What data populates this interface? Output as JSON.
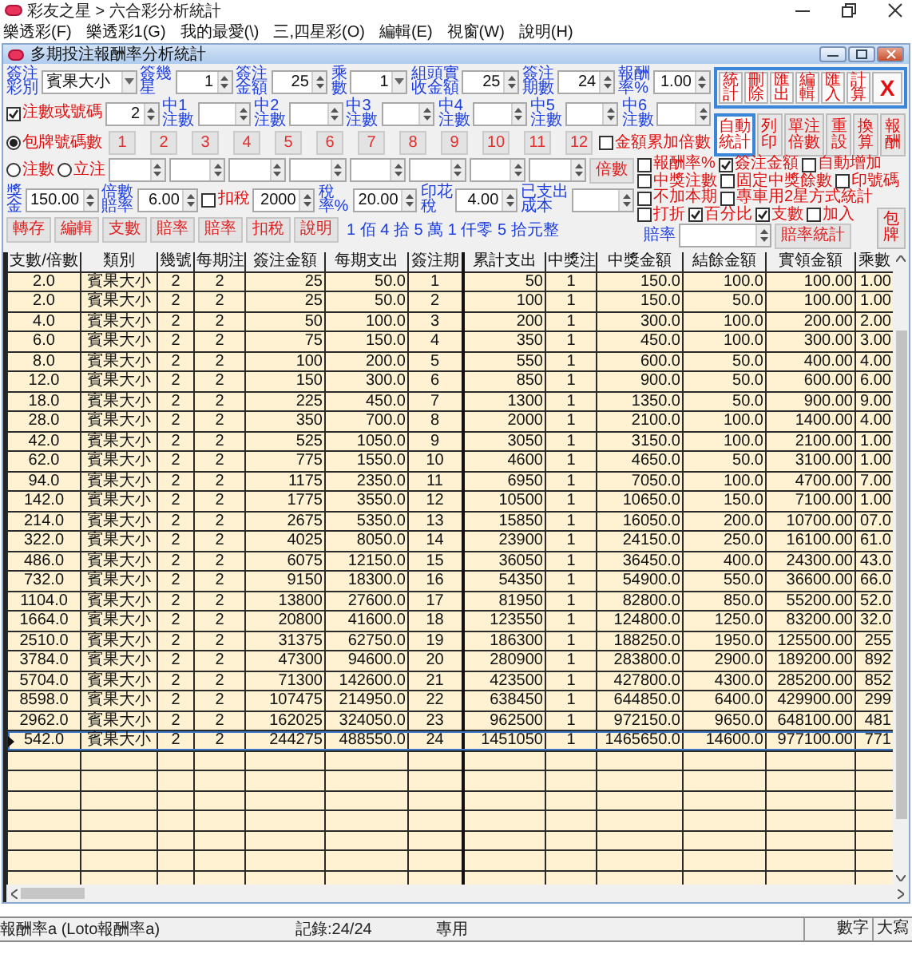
{
  "window": {
    "title": "彩友之星 > 六合彩分析統計"
  },
  "menu": [
    "樂透彩(F)",
    "樂透彩1(G)",
    "我的最愛(\\)",
    "三,四星彩(O)",
    "編輯(E)",
    "視窗(W)",
    "說明(H)"
  ],
  "dialog": {
    "title": "多期投注報酬率分析統計"
  },
  "form": {
    "upper_rows": [
      [
        {
          "kind": "label",
          "text": "簽注彩別"
        },
        {
          "kind": "select",
          "value": "賓果大小"
        },
        {
          "kind": "label",
          "text": "簽幾星"
        },
        {
          "kind": "spin",
          "value": "1"
        },
        {
          "kind": "label",
          "text": "簽注金額"
        },
        {
          "kind": "spin",
          "value": "25"
        },
        {
          "kind": "label",
          "text": "乘數"
        },
        {
          "kind": "select",
          "value": "1"
        },
        {
          "kind": "label",
          "text": "組頭實收金額"
        },
        {
          "kind": "spin",
          "value": "25"
        },
        {
          "kind": "label",
          "text": "簽注期數"
        },
        {
          "kind": "spin",
          "value": "24"
        },
        {
          "kind": "label",
          "text": "報酬率%"
        },
        {
          "kind": "spin",
          "value": "1.00"
        }
      ],
      [
        {
          "kind": "checkbox",
          "label": "注數或號碼",
          "checked": true
        },
        {
          "kind": "spin",
          "value": "2"
        },
        {
          "kind": "label",
          "text": "中1注數"
        },
        {
          "kind": "spin"
        },
        {
          "kind": "label",
          "text": "中2注數"
        },
        {
          "kind": "spin"
        },
        {
          "kind": "label",
          "text": "中3注數"
        },
        {
          "kind": "spin"
        },
        {
          "kind": "label",
          "text": "中4注數"
        },
        {
          "kind": "spin"
        },
        {
          "kind": "label",
          "text": "中5注數"
        },
        {
          "kind": "spin"
        },
        {
          "kind": "label",
          "text": "中6注數"
        },
        {
          "kind": "spin"
        }
      ],
      [
        {
          "kind": "radio",
          "label": "包牌號碼數",
          "selected": true
        },
        {
          "kind": "number_buttons",
          "labels": [
            "1",
            "2",
            "3",
            "4",
            "5",
            "6",
            "7",
            "8",
            "9",
            "10",
            "11",
            "12"
          ]
        },
        {
          "kind": "checkbox",
          "label": "金額累加倍數",
          "checked": false
        }
      ]
    ],
    "lower_rows": [
      [
        {
          "kind": "radio",
          "label": "注數",
          "selected": false
        },
        {
          "kind": "radio",
          "label": "立注",
          "selected": false
        },
        {
          "kind": "spin"
        },
        {
          "kind": "spin"
        },
        {
          "kind": "spin"
        },
        {
          "kind": "spin"
        },
        {
          "kind": "spin"
        },
        {
          "kind": "spin"
        },
        {
          "kind": "spin"
        },
        {
          "kind": "spin"
        },
        {
          "kind": "button",
          "label": "倍數"
        }
      ],
      [
        {
          "kind": "label",
          "text": "獎金"
        },
        {
          "kind": "spin",
          "value": "150.00"
        },
        {
          "kind": "label",
          "text": "倍數賠率"
        },
        {
          "kind": "spin",
          "value": "6.00"
        },
        {
          "kind": "checkbox",
          "label": "扣稅",
          "checked": false
        },
        {
          "kind": "spin",
          "value": "2000"
        },
        {
          "kind": "label",
          "text": "稅率%"
        },
        {
          "kind": "spin",
          "value": "20.00"
        },
        {
          "kind": "label",
          "text": "印花稅"
        },
        {
          "kind": "spin",
          "value": "4.00"
        },
        {
          "kind": "label",
          "text": "已支出成本"
        },
        {
          "kind": "spin"
        }
      ],
      [
        {
          "kind": "button",
          "label": "轉存"
        },
        {
          "kind": "button",
          "label": "編輯"
        },
        {
          "kind": "button",
          "label": "支數"
        },
        {
          "kind": "button",
          "label": "賠率"
        },
        {
          "kind": "button",
          "label": "賠率"
        },
        {
          "kind": "button",
          "label": "扣稅"
        },
        {
          "kind": "button",
          "label": "說明"
        },
        {
          "kind": "text",
          "text": "1 佰 4 拾 5 萬 1 仟零 5 拾元整"
        }
      ]
    ]
  },
  "toolbar": [
    {
      "label": "統計",
      "kind": "text"
    },
    {
      "label": "刪除",
      "kind": "text"
    },
    {
      "label": "匯出",
      "kind": "text"
    },
    {
      "label": "編輯",
      "kind": "text"
    },
    {
      "label": "匯入",
      "kind": "text"
    },
    {
      "label": "計算",
      "kind": "text"
    },
    {
      "label": "X",
      "kind": "close"
    }
  ],
  "toolbar2": [
    {
      "label": "自動統計",
      "focused": true
    },
    {
      "label": "列印",
      "focused": false
    },
    {
      "label": "單注倍數",
      "focused": false
    },
    {
      "label": "重設",
      "focused": false
    },
    {
      "label": "換算",
      "focused": false
    },
    {
      "label": "報酬",
      "focused": false
    }
  ],
  "options": [
    [
      {
        "label": "報酬率%",
        "checked": false
      },
      {
        "label": "簽注金額",
        "checked": true
      },
      {
        "label": "自動增加",
        "checked": false
      }
    ],
    [
      {
        "label": "中獎注數",
        "checked": false
      },
      {
        "label": "固定中獎餘數",
        "checked": false
      },
      {
        "label": "印號碼",
        "checked": false
      }
    ],
    [
      {
        "label": "不加本期",
        "checked": false
      },
      {
        "label": "專車用2星方式統計",
        "checked": false
      }
    ],
    [
      {
        "label": "打折",
        "checked": false
      },
      {
        "label": "百分比",
        "checked": true
      },
      {
        "label": "支數",
        "checked": true
      },
      {
        "label": "加入",
        "checked": false
      }
    ]
  ],
  "odds": {
    "label": "賠率",
    "button": "賠率統計"
  },
  "pack_button": "包牌",
  "table": {
    "columns": [
      "支數/倍數",
      "類別",
      "幾號",
      "每期注",
      "簽注金額",
      "每期支出",
      "簽注期",
      "累計支出",
      "中獎注",
      "中獎金額",
      "結餘金額",
      "實領金額",
      "乘數"
    ],
    "rows": [
      {
        "cells": [
          "2.0",
          "賓果大小",
          "2",
          "2",
          "25",
          "50.0",
          "1",
          "50",
          "1",
          "150.0",
          "100.0",
          "100.00",
          "1.00"
        ],
        "selected": false
      },
      {
        "cells": [
          "2.0",
          "賓果大小",
          "2",
          "2",
          "25",
          "50.0",
          "2",
          "100",
          "1",
          "150.0",
          "50.0",
          "100.00",
          "1.00"
        ],
        "selected": false
      },
      {
        "cells": [
          "4.0",
          "賓果大小",
          "2",
          "2",
          "50",
          "100.0",
          "3",
          "200",
          "1",
          "300.0",
          "100.0",
          "200.00",
          "2.00"
        ],
        "selected": false
      },
      {
        "cells": [
          "6.0",
          "賓果大小",
          "2",
          "2",
          "75",
          "150.0",
          "4",
          "350",
          "1",
          "450.0",
          "100.0",
          "300.00",
          "3.00"
        ],
        "selected": false
      },
      {
        "cells": [
          "8.0",
          "賓果大小",
          "2",
          "2",
          "100",
          "200.0",
          "5",
          "550",
          "1",
          "600.0",
          "50.0",
          "400.00",
          "4.00"
        ],
        "selected": false
      },
      {
        "cells": [
          "12.0",
          "賓果大小",
          "2",
          "2",
          "150",
          "300.0",
          "6",
          "850",
          "1",
          "900.0",
          "50.0",
          "600.00",
          "6.00"
        ],
        "selected": false
      },
      {
        "cells": [
          "18.0",
          "賓果大小",
          "2",
          "2",
          "225",
          "450.0",
          "7",
          "1300",
          "1",
          "1350.0",
          "50.0",
          "900.00",
          "9.00"
        ],
        "selected": false
      },
      {
        "cells": [
          "28.0",
          "賓果大小",
          "2",
          "2",
          "350",
          "700.0",
          "8",
          "2000",
          "1",
          "2100.0",
          "100.0",
          "1400.00",
          "4.00"
        ],
        "selected": false
      },
      {
        "cells": [
          "42.0",
          "賓果大小",
          "2",
          "2",
          "525",
          "1050.0",
          "9",
          "3050",
          "1",
          "3150.0",
          "100.0",
          "2100.00",
          "1.00"
        ],
        "selected": false
      },
      {
        "cells": [
          "62.0",
          "賓果大小",
          "2",
          "2",
          "775",
          "1550.0",
          "10",
          "4600",
          "1",
          "4650.0",
          "50.0",
          "3100.00",
          "1.00"
        ],
        "selected": false
      },
      {
        "cells": [
          "94.0",
          "賓果大小",
          "2",
          "2",
          "1175",
          "2350.0",
          "11",
          "6950",
          "1",
          "7050.0",
          "100.0",
          "4700.00",
          "7.00"
        ],
        "selected": false
      },
      {
        "cells": [
          "142.0",
          "賓果大小",
          "2",
          "2",
          "1775",
          "3550.0",
          "12",
          "10500",
          "1",
          "10650.0",
          "150.0",
          "7100.00",
          "1.00"
        ],
        "selected": false
      },
      {
        "cells": [
          "214.0",
          "賓果大小",
          "2",
          "2",
          "2675",
          "5350.0",
          "13",
          "15850",
          "1",
          "16050.0",
          "200.0",
          "10700.00",
          "07.0"
        ],
        "selected": false
      },
      {
        "cells": [
          "322.0",
          "賓果大小",
          "2",
          "2",
          "4025",
          "8050.0",
          "14",
          "23900",
          "1",
          "24150.0",
          "250.0",
          "16100.00",
          "61.0"
        ],
        "selected": false
      },
      {
        "cells": [
          "486.0",
          "賓果大小",
          "2",
          "2",
          "6075",
          "12150.0",
          "15",
          "36050",
          "1",
          "36450.0",
          "400.0",
          "24300.00",
          "43.0"
        ],
        "selected": false
      },
      {
        "cells": [
          "732.0",
          "賓果大小",
          "2",
          "2",
          "9150",
          "18300.0",
          "16",
          "54350",
          "1",
          "54900.0",
          "550.0",
          "36600.00",
          "66.0"
        ],
        "selected": false
      },
      {
        "cells": [
          "1104.0",
          "賓果大小",
          "2",
          "2",
          "13800",
          "27600.0",
          "17",
          "81950",
          "1",
          "82800.0",
          "850.0",
          "55200.00",
          "52.0"
        ],
        "selected": false
      },
      {
        "cells": [
          "1664.0",
          "賓果大小",
          "2",
          "2",
          "20800",
          "41600.0",
          "18",
          "123550",
          "1",
          "124800.0",
          "1250.0",
          "83200.00",
          "32.0"
        ],
        "selected": false
      },
      {
        "cells": [
          "2510.0",
          "賓果大小",
          "2",
          "2",
          "31375",
          "62750.0",
          "19",
          "186300",
          "1",
          "188250.0",
          "1950.0",
          "125500.00",
          "255"
        ],
        "selected": false
      },
      {
        "cells": [
          "3784.0",
          "賓果大小",
          "2",
          "2",
          "47300",
          "94600.0",
          "20",
          "280900",
          "1",
          "283800.0",
          "2900.0",
          "189200.00",
          "892"
        ],
        "selected": false
      },
      {
        "cells": [
          "5704.0",
          "賓果大小",
          "2",
          "2",
          "71300",
          "142600.0",
          "21",
          "423500",
          "1",
          "427800.0",
          "4300.0",
          "285200.00",
          "852"
        ],
        "selected": false
      },
      {
        "cells": [
          "8598.0",
          "賓果大小",
          "2",
          "2",
          "107475",
          "214950.0",
          "22",
          "638450",
          "1",
          "644850.0",
          "6400.0",
          "429900.00",
          "299"
        ],
        "selected": false
      },
      {
        "cells": [
          "2962.0",
          "賓果大小",
          "2",
          "2",
          "162025",
          "324050.0",
          "23",
          "962500",
          "1",
          "972150.0",
          "9650.0",
          "648100.00",
          "481"
        ],
        "selected": false
      },
      {
        "cells": [
          "542.0",
          "賓果大小",
          "2",
          "2",
          "244275",
          "488550.0",
          "24",
          "1451050",
          "1",
          "1465650.0",
          "14600.0",
          "977100.00",
          "771"
        ],
        "selected": true
      }
    ]
  },
  "status_bar": [
    {
      "text": "報酬率a (Loto報酬率a)",
      "kind": "message"
    },
    {
      "text": "記錄:24/24",
      "kind": "message"
    },
    {
      "text": "專用",
      "kind": "message"
    },
    {
      "text": "數字",
      "kind": "pane"
    },
    {
      "text": "大寫",
      "kind": "pane"
    }
  ]
}
